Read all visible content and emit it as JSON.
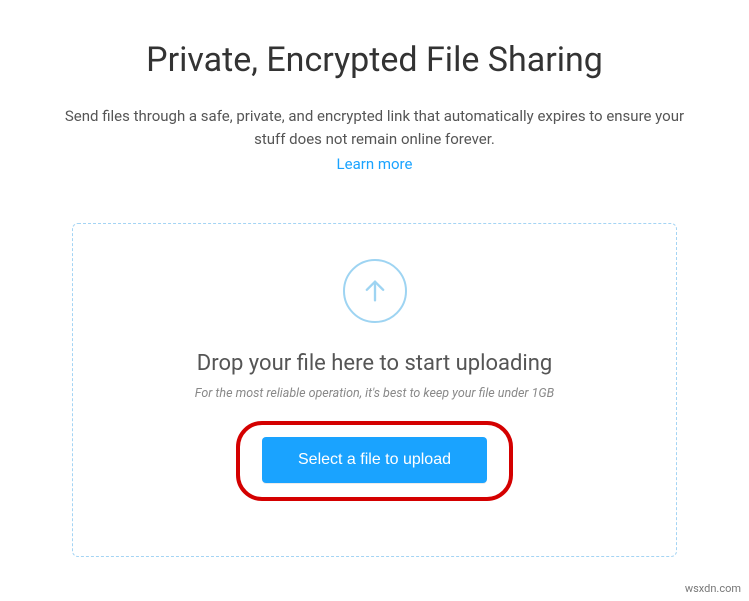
{
  "header": {
    "title": "Private, Encrypted File Sharing",
    "description": "Send files through a safe, private, and encrypted link that automatically expires to ensure your stuff does not remain online forever.",
    "learn_more_label": "Learn more"
  },
  "dropzone": {
    "heading": "Drop your file here to start uploading",
    "hint": "For the most reliable operation, it's best to keep your file under 1GB",
    "select_button_label": "Select a file to upload"
  },
  "colors": {
    "accent": "#1aa3ff",
    "dashed_border": "#a4d4f4",
    "annotation": "#d40000"
  },
  "watermark": "wsxdn.com"
}
